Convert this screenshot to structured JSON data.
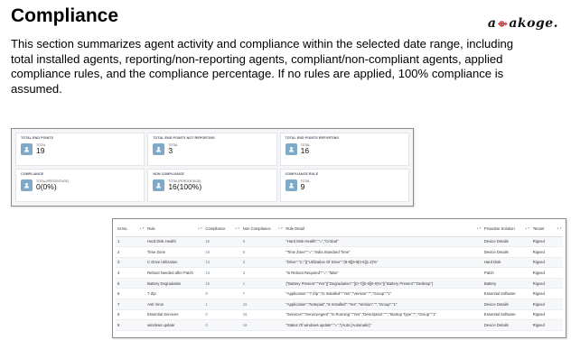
{
  "header": {
    "title": "Compliance",
    "logo_text_a": "a",
    "logo_mark": "⟴",
    "logo_text_b": "akoge.",
    "description": "This section summarizes agent activity and compliance within the selected date range, including total installed agents, reporting/non-reporting agents, compliant/non-compliant agents, applied compliance rules, and the compliance percentage. If no rules are applied, 100% compliance is assumed."
  },
  "cards": [
    {
      "title": "TOTAL END POINTS",
      "sub": "TOTAL",
      "value": "19",
      "icon": "user-icon"
    },
    {
      "title": "TOTAL END POINTS NOT REPORTING",
      "sub": "TOTAL",
      "value": "3",
      "icon": "user-icon"
    },
    {
      "title": "TOTAL END POINTS REPORTING",
      "sub": "TOTAL",
      "value": "16",
      "icon": "user-icon"
    },
    {
      "title": "COMPLIANCE",
      "sub": "TOTAL(PERCENTAGE)",
      "value": "0(0%)",
      "icon": "user-icon"
    },
    {
      "title": "NON COMPLIANCE",
      "sub": "TOTAL(PERCENTAGE)",
      "value": "16(100%)",
      "icon": "user-icon"
    },
    {
      "title": "COMPLIANCE RULE",
      "sub": "TOTAL",
      "value": "9",
      "icon": "user-icon"
    }
  ],
  "table": {
    "headers": [
      "Sr.No.",
      "Rule",
      "Compliance",
      "Non Compliance",
      "Rule Detail",
      "Proactive Solution",
      "Tenant"
    ],
    "rows": [
      [
        "1",
        "Hard Disk Health",
        "16",
        "0",
        "\"Hard Disk Health\":\"=\",\"Critical\"",
        "Device Details",
        "Rigved"
      ],
      [
        "2",
        "Time Zone",
        "16",
        "0",
        "\"Time Zone\":\"=\",\"India Standard Time\"",
        "Device Details",
        "Rigved"
      ],
      [
        "3",
        "C Drive Utilization",
        "13",
        "3",
        "\"Drive\":\"C:\"}{\"Utilization Of Drive\":\"(8-9]|9-9[0-9]|1.2)%\"",
        "Hard Disk",
        "Rigved"
      ],
      [
        "4",
        "Reboot Needed after Patch",
        "13",
        "3",
        "\"Is Reboot Required\":\"=\",\"false\"",
        "Patch",
        "Rigved"
      ],
      [
        "5",
        "Battery Degradation",
        "15",
        "1",
        "{\"Battery Present\":\"Yes\"}{\"Degradation\":\"[(0-7][0-9]|0-9)%\"}{\"Battery Present\":\"Desktop\"}",
        "Battery",
        "Rigved"
      ],
      [
        "6",
        "7-Zip",
        "9",
        "7",
        "\"Application\":\"7-Zip\",\"Is Installed\":\"Yes\",\"Version\":\"\",\"Group\":\"1\"",
        "Essential Software",
        "Rigved"
      ],
      [
        "7",
        "Anti Virus",
        "1",
        "15",
        "\"Application\":\"Notepad\",\"Is Installed\":\"Yes\",\"Version\":\"\",\"Group\":\"1\"",
        "Device Details",
        "Rigved"
      ],
      [
        "8",
        "Essential Services",
        "0",
        "16",
        "\"Services\":\"ServiceAgent\",\"Is Running\":\"Yes\",\"Description\":\"\",\"Startup Type\":\"\",\"Group\":\"1\"",
        "Essential Software",
        "Rigved"
      ],
      [
        "9",
        "windows update",
        "0",
        "16",
        "\"Status Of windows update\":\"=\",\"(Auto [Automatic)\"",
        "Device Details",
        "Rigved"
      ]
    ]
  }
}
